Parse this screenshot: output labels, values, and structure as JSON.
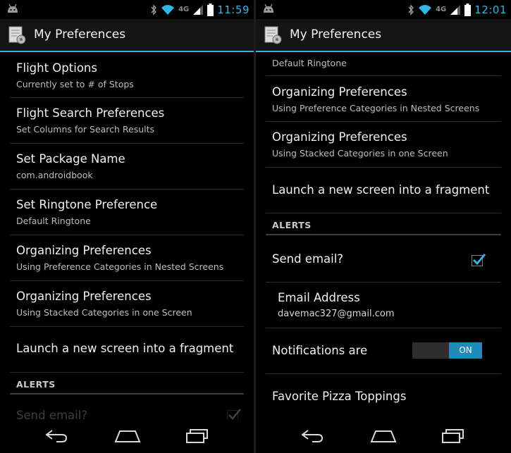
{
  "colors": {
    "accent": "#33b5e5",
    "background": "#000000",
    "actionbar": "#141414",
    "toggle_on": "#1e8bb8"
  },
  "left": {
    "status": {
      "network": "4G",
      "time": "11:59",
      "icons": [
        "android-icon",
        "bluetooth-icon",
        "wifi-icon",
        "signal-icon",
        "battery-icon"
      ]
    },
    "actionbar": {
      "title": "My Preferences",
      "icon": "preferences-app-icon"
    },
    "items": [
      {
        "title": "Flight Options",
        "summary": "Currently set to # of Stops"
      },
      {
        "title": "Flight Search Preferences",
        "summary": "Set Columns for Search Results"
      },
      {
        "title": "Set Package Name",
        "summary": "com.androidbook"
      },
      {
        "title": "Set Ringtone Preference",
        "summary": "Default Ringtone"
      },
      {
        "title": "Organizing Preferences",
        "summary": "Using Preference Categories in Nested Screens"
      },
      {
        "title": "Organizing Preferences",
        "summary": "Using Stacked Categories in one Screen"
      },
      {
        "title": "Launch a new screen into a fragment"
      }
    ],
    "category": "ALERTS",
    "partial_item": {
      "title": "Send email?",
      "checked": true
    },
    "nav": [
      "back-icon",
      "home-icon",
      "recent-apps-icon"
    ]
  },
  "right": {
    "status": {
      "network": "4G",
      "time": "12:01",
      "icons": [
        "android-icon",
        "bluetooth-icon",
        "wifi-icon",
        "signal-icon",
        "battery-icon"
      ]
    },
    "actionbar": {
      "title": "My Preferences",
      "icon": "preferences-app-icon"
    },
    "partial_summary": "Default Ringtone",
    "items": [
      {
        "title": "Organizing Preferences",
        "summary": "Using Preference Categories in Nested Screens"
      },
      {
        "title": "Organizing Preferences",
        "summary": "Using Stacked Categories in one Screen"
      },
      {
        "title": "Launch a new screen into a fragment"
      }
    ],
    "category": "ALERTS",
    "send_email": {
      "title": "Send email?",
      "checked": true
    },
    "email": {
      "title": "Email Address",
      "value": "davemac327@gmail.com"
    },
    "notifications": {
      "title": "Notifications are",
      "state": "ON"
    },
    "pizza": {
      "title": "Favorite Pizza Toppings"
    },
    "nav": [
      "back-icon",
      "home-icon",
      "recent-apps-icon"
    ]
  }
}
